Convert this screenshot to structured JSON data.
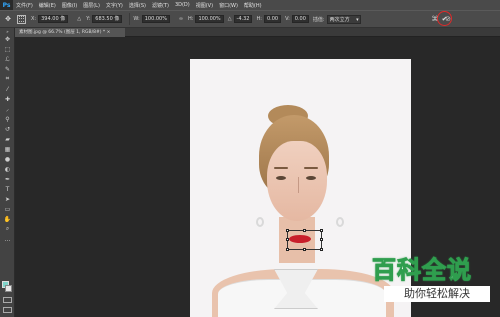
{
  "menubar": {
    "logo": "Ps",
    "items": [
      "文件(F)",
      "编辑(E)",
      "图像(I)",
      "图层(L)",
      "文字(Y)",
      "选择(S)",
      "滤镜(T)",
      "3D(D)",
      "视图(V)",
      "窗口(W)",
      "帮助(H)"
    ]
  },
  "options": {
    "x_label": "X:",
    "x_value": "394.00 像",
    "y_label": "Y:",
    "y_value": "683.50 像",
    "w_label": "W:",
    "w_value": "100.00%",
    "h_label": "H:",
    "h_value": "100.00%",
    "angle_label": "△",
    "angle_value": "-4.32",
    "skewh_label": "H:",
    "skewh_value": "0.00",
    "skewv_label": "V:",
    "skewv_value": "0.00",
    "interp_label": "插值:",
    "interp_value": "两次立方"
  },
  "document_tab": {
    "title": "素材图.jpg @ 66.7% (图层 1, RGB/8#) * ×"
  },
  "watermark": {
    "title": "百科全说",
    "subtitle": "助你轻松解决"
  },
  "colors": {
    "accent_commit_ring": "#e02a2a",
    "foreground_swatch": "#7fd3c9",
    "watermark_green": "#2f9e4e"
  }
}
